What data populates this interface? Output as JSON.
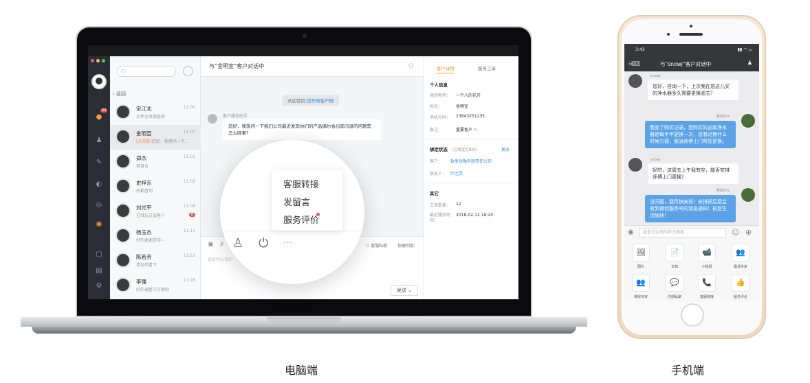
{
  "laptop": {
    "sidebar": {
      "badge": "33"
    },
    "contacts": {
      "back_label": "返回",
      "items": [
        {
          "name": "宋江北",
          "msg": "文件已发请查收",
          "time": "11:00"
        },
        {
          "name": "金明宣",
          "tag": "[未回复]",
          "msg": "您好，我想问一下...",
          "time": "11:00"
        },
        {
          "name": "郑杰",
          "msg": "项目合",
          "time": "11:01"
        },
        {
          "name": "史梓东",
          "msg": "外勤签到",
          "time": "11:02"
        },
        {
          "name": "刘光平",
          "msg": "已拜访过该客户",
          "time": "11:08",
          "badge": "8"
        },
        {
          "name": "杨玉杰",
          "msg": "好的谢谢支持~",
          "time": "11:11"
        },
        {
          "name": "陈若芳",
          "msg": "请包后看下",
          "time": "11:22"
        },
        {
          "name": "李强",
          "msg": "好的调整下方案吧",
          "time": "11:28"
        }
      ]
    },
    "chat": {
      "title": "与“金明宣”客户对话中",
      "welcome_prefix": "欢迎使用",
      "welcome_link": "团车网客户群",
      "sender": "客户服务助手",
      "message": "您好，我想问一下我们公司最近发现你们的产品偶尔会出现闪退的问题是怎么回事？",
      "private_label": "客服私聊",
      "quick_reply": "快捷回复",
      "input_placeholder": "此处为公司的",
      "send_label": "发送"
    },
    "menu": {
      "items": [
        "客服转接",
        "发留言",
        "服务评价"
      ]
    },
    "detail": {
      "tabs": [
        "客户详情",
        "服务工单"
      ],
      "personal_title": "个人信息",
      "fields": [
        {
          "label": "微信昵称：",
          "value": "一个人的花开"
        },
        {
          "label": "姓名：",
          "value": "金明宣"
        },
        {
          "label": "手机号码：",
          "value": "13843251235"
        },
        {
          "label": "备注：",
          "value": "重要客户"
        }
      ],
      "bind_title": "绑定状态",
      "bind_status": "(已绑定CRM)",
      "bind_edit": "更改",
      "customer_label": "客户：",
      "customer_value": "致享金融有限责任公司",
      "contact_label": "联系人：",
      "contact_value": "叶之灵",
      "other_title": "其它",
      "order_label": "工单数量：",
      "order_value": "12",
      "last_label": "最近服务时间：",
      "last_value": "2018-02-12  18:20"
    }
  },
  "phone": {
    "time": "3:43",
    "back": "返回",
    "title": "与“snowj”客户对话中",
    "messages": [
      {
        "side": "left",
        "name": "snowj",
        "text": "您好，咨询一下，上次我在您这儿买的净水器多久需要更换滤芯？"
      },
      {
        "side": "right",
        "name": "林松Eric",
        "text": "我查了购买记录，您购买的这款净水器是每半年更换一次，您看近期什么时候方便，我派师傅上门帮您更换。"
      },
      {
        "side": "left",
        "name": "snowj",
        "text": "好的，这周五上午我有空，能否安排师傅上门更换？"
      },
      {
        "side": "right",
        "name": "林松Eric",
        "text": "没问题，我尽快安排！安排好后您会收到微信服务号的消息通知！祝您生活愉快！"
      }
    ],
    "input_placeholder": "此处为公司的官方回复",
    "tools": [
      {
        "icon": "🖼",
        "label": "图片"
      },
      {
        "icon": "📄",
        "label": "文档"
      },
      {
        "icon": "📹",
        "label": "小视频"
      },
      {
        "icon": "👥",
        "label": "邀请专家"
      },
      {
        "icon": "👥",
        "label": "移除专家"
      },
      {
        "icon": "💬",
        "label": "内部私聊"
      },
      {
        "icon": "📞",
        "label": "客服转接"
      },
      {
        "icon": "👍",
        "label": "服务评价"
      }
    ]
  },
  "captions": {
    "left": "电脑端",
    "right": "手机端"
  },
  "colors": {
    "accent": "#f39c3b",
    "link": "#3a8ee6",
    "bubble_blue": "#5ba3e6"
  }
}
